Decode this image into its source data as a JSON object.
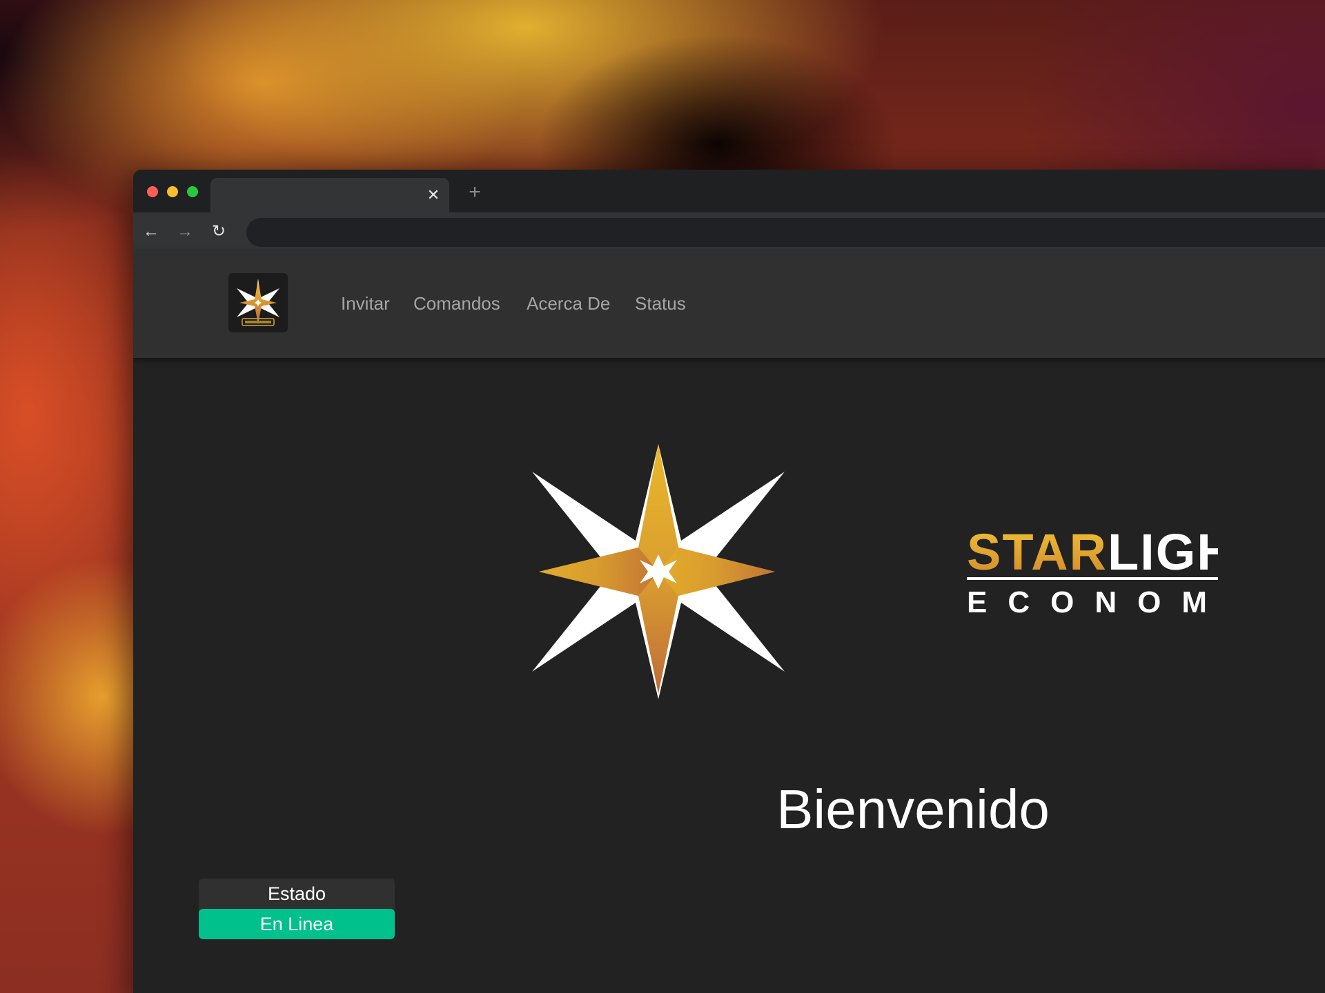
{
  "browser": {
    "tab_title": "",
    "tab_close_glyph": "✕",
    "new_tab_glyph": "+",
    "url": "",
    "back_glyph": "←",
    "forward_glyph": "→",
    "reload_glyph": "↻"
  },
  "nav": {
    "logo_icon": "starlight-star-logo-icon",
    "links": [
      "Invitar",
      "Comandos",
      "Acerca De",
      "Status"
    ]
  },
  "hero": {
    "logo_word_1": "STAR",
    "logo_word_2": "LIGHT",
    "logo_subtitle": "ECONOMY",
    "welcome": "Bienvenido"
  },
  "status": {
    "label": "Estado",
    "value": "En Linea",
    "value_color": "#00c08b"
  },
  "colors": {
    "gold": "#e2b03a",
    "gold_dark": "#c8862e",
    "page_bg": "#222222",
    "nav_bg": "#303030"
  }
}
